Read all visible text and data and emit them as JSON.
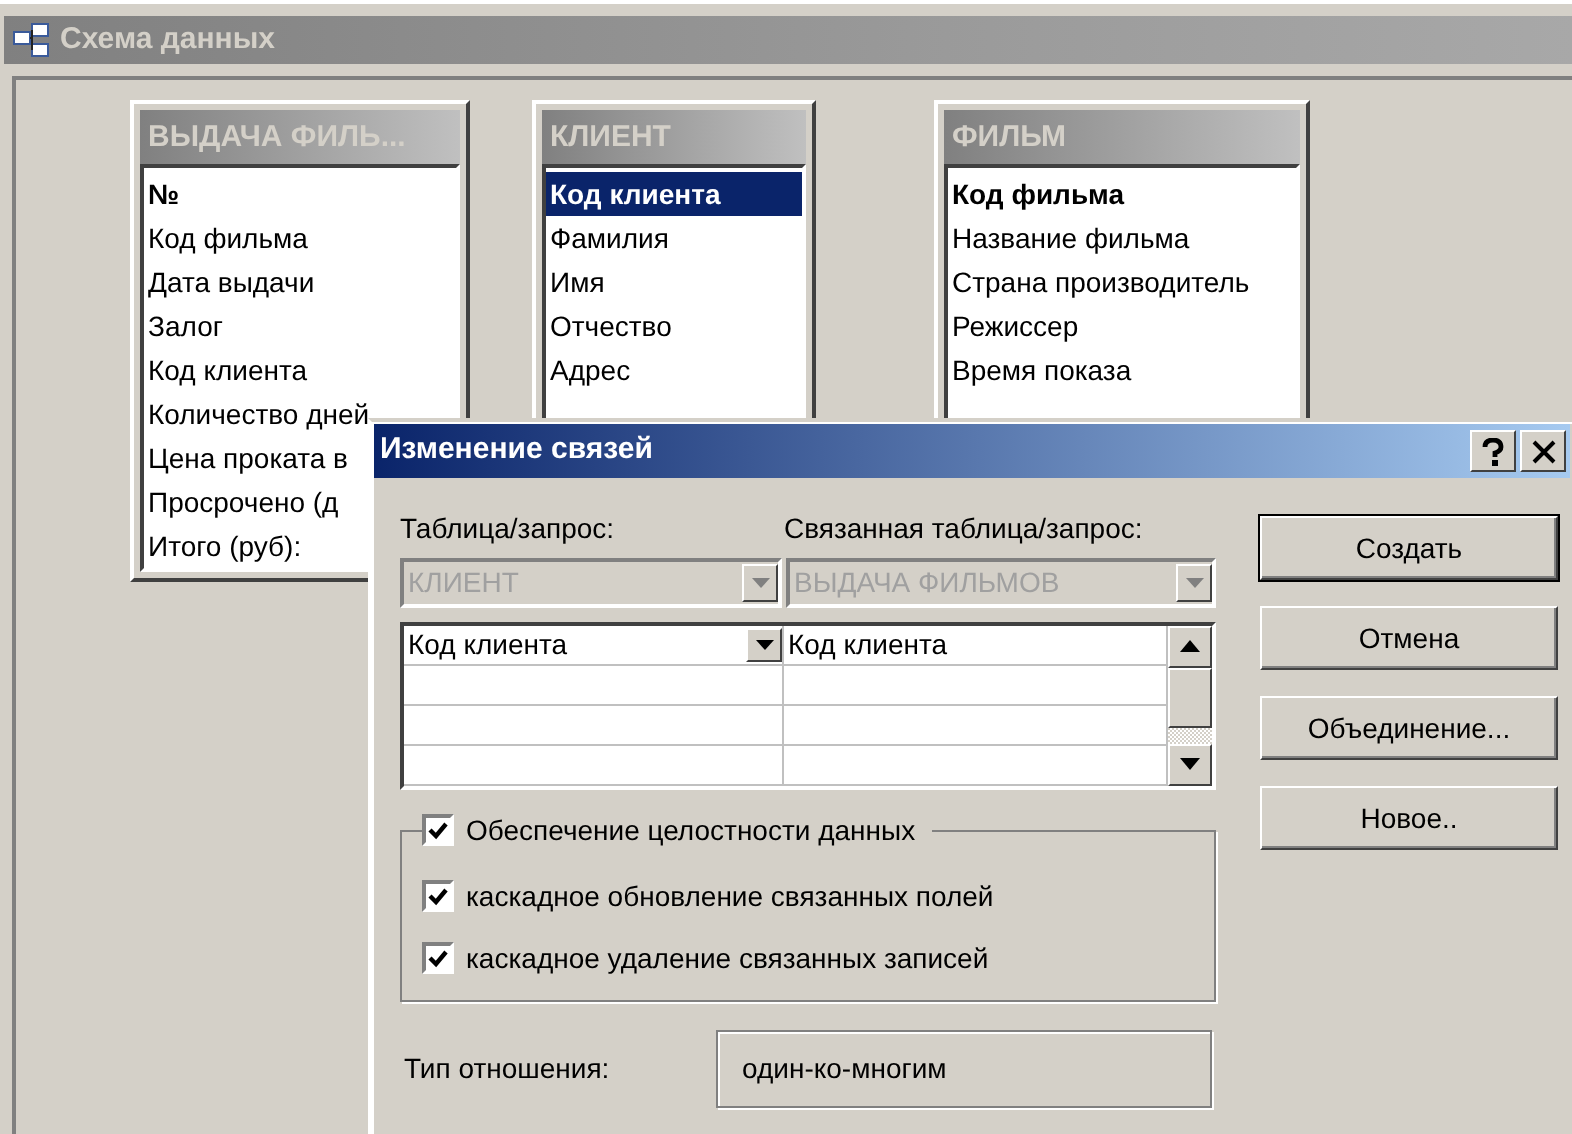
{
  "window": {
    "title": "Схема данных"
  },
  "tables": [
    {
      "title": "ВЫДАЧА ФИЛЬ...",
      "fields": [
        {
          "name": "№",
          "key": true,
          "selected": false
        },
        {
          "name": "Код фильма",
          "key": false,
          "selected": false
        },
        {
          "name": "Дата выдачи",
          "key": false,
          "selected": false
        },
        {
          "name": "Залог",
          "key": false,
          "selected": false
        },
        {
          "name": "Код клиента",
          "key": false,
          "selected": false
        },
        {
          "name": "Количество дней",
          "key": false,
          "selected": false
        },
        {
          "name": "Цена проката в",
          "key": false,
          "selected": false
        },
        {
          "name": "Просрочено (д",
          "key": false,
          "selected": false
        },
        {
          "name": "Итого (руб):",
          "key": false,
          "selected": false
        }
      ]
    },
    {
      "title": "КЛИЕНТ",
      "fields": [
        {
          "name": "Код клиента",
          "key": true,
          "selected": true
        },
        {
          "name": "Фамилия",
          "key": false,
          "selected": false
        },
        {
          "name": "Имя",
          "key": false,
          "selected": false
        },
        {
          "name": "Отчество",
          "key": false,
          "selected": false
        },
        {
          "name": "Адрес",
          "key": false,
          "selected": false
        }
      ]
    },
    {
      "title": "ФИЛЬМ",
      "fields": [
        {
          "name": "Код фильма",
          "key": true,
          "selected": false
        },
        {
          "name": "Название фильма",
          "key": false,
          "selected": false
        },
        {
          "name": "Страна производитель",
          "key": false,
          "selected": false
        },
        {
          "name": "Режиссер",
          "key": false,
          "selected": false
        },
        {
          "name": "Время показа",
          "key": false,
          "selected": false
        }
      ]
    }
  ],
  "dialog": {
    "title": "Изменение связей",
    "table_label": "Таблица/запрос:",
    "table_value": "КЛИЕНТ",
    "table_disabled": true,
    "related_label": "Связанная таблица/запрос:",
    "related_value": "ВЫДАЧА ФИЛЬМОВ",
    "related_disabled": true,
    "field_pairs": [
      {
        "left": "Код клиента",
        "right": "Код клиента"
      }
    ],
    "integrity": {
      "label": "Обеспечение целостности данных",
      "checked": true
    },
    "options": [
      {
        "label": "каскадное обновление связанных полей",
        "checked": true
      },
      {
        "label": "каскадное удаление связанных записей",
        "checked": true
      }
    ],
    "relationship_label": "Тип отношения:",
    "relationship_value": "один-ко-многим",
    "buttons": [
      {
        "label": "Создать",
        "default": true
      },
      {
        "label": "Отмена",
        "default": false
      },
      {
        "label": "Объединение...",
        "default": false
      },
      {
        "label": "Новое..",
        "default": false
      }
    ]
  }
}
